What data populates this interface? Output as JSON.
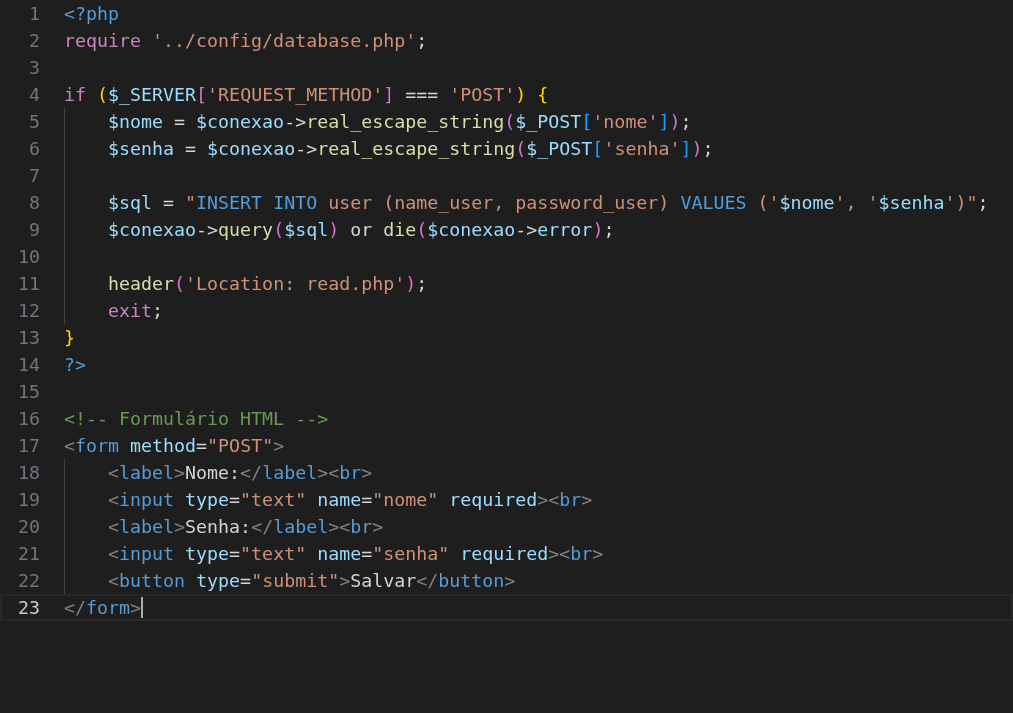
{
  "editor": {
    "lines": [
      {
        "number": "1",
        "selected": false,
        "indented": false,
        "tokens": [
          {
            "kind": "phptag",
            "text": "<?php"
          }
        ]
      },
      {
        "number": "2",
        "selected": false,
        "indented": false,
        "tokens": [
          {
            "kind": "keyword",
            "text": "require"
          },
          {
            "kind": "string",
            "text": " '../config/database.php'"
          },
          {
            "kind": "plain",
            "text": ";"
          }
        ]
      },
      {
        "number": "3",
        "selected": false,
        "indented": false
      },
      {
        "number": "4",
        "selected": false,
        "indented": false,
        "tokens": [
          {
            "kind": "keyword",
            "text": "if"
          },
          {
            "kind": "bracket1",
            "text": " ("
          },
          {
            "kind": "variable",
            "text": "$_SERVER"
          },
          {
            "kind": "bracket2",
            "text": "["
          },
          {
            "kind": "string",
            "text": "'REQUEST_METHOD'"
          },
          {
            "kind": "bracket2",
            "text": "]"
          },
          {
            "kind": "plain",
            "text": " === "
          },
          {
            "kind": "string",
            "text": "'POST'"
          },
          {
            "kind": "bracket1",
            "text": ")"
          },
          {
            "kind": "bracket1",
            "text": " {"
          }
        ]
      },
      {
        "number": "5",
        "selected": false,
        "indented": true,
        "tokens": [
          {
            "kind": "variable",
            "text": "$nome"
          },
          {
            "kind": "plain",
            "text": " = "
          },
          {
            "kind": "variable",
            "text": "$conexao"
          },
          {
            "kind": "plain",
            "text": "->"
          },
          {
            "kind": "function",
            "text": "real_escape_string"
          },
          {
            "kind": "bracket2",
            "text": "("
          },
          {
            "kind": "variable",
            "text": "$_POST"
          },
          {
            "kind": "bracket3",
            "text": "["
          },
          {
            "kind": "string",
            "text": "'nome'"
          },
          {
            "kind": "bracket3",
            "text": "]"
          },
          {
            "kind": "bracket2",
            "text": ")"
          },
          {
            "kind": "plain",
            "text": ";"
          }
        ]
      },
      {
        "number": "6",
        "selected": false,
        "indented": true,
        "tokens": [
          {
            "kind": "variable",
            "text": "$senha"
          },
          {
            "kind": "plain",
            "text": " = "
          },
          {
            "kind": "variable",
            "text": "$conexao"
          },
          {
            "kind": "plain",
            "text": "->"
          },
          {
            "kind": "function",
            "text": "real_escape_string"
          },
          {
            "kind": "bracket2",
            "text": "("
          },
          {
            "kind": "variable",
            "text": "$_POST"
          },
          {
            "kind": "bracket3",
            "text": "["
          },
          {
            "kind": "string",
            "text": "'senha'"
          },
          {
            "kind": "bracket3",
            "text": "]"
          },
          {
            "kind": "bracket2",
            "text": ")"
          },
          {
            "kind": "plain",
            "text": ";"
          }
        ]
      },
      {
        "number": "7",
        "selected": false,
        "indented": true
      },
      {
        "number": "8",
        "selected": false,
        "indented": true,
        "tokens": [
          {
            "kind": "variable",
            "text": "$sql"
          },
          {
            "kind": "plain",
            "text": " = "
          },
          {
            "kind": "string",
            "text": "\""
          },
          {
            "kind": "sql",
            "text": "INSERT INTO"
          },
          {
            "kind": "string",
            "text": " user (name_user, password_user) "
          },
          {
            "kind": "sql",
            "text": "VALUES"
          },
          {
            "kind": "string",
            "text": " ('"
          },
          {
            "kind": "variable",
            "text": "$nome"
          },
          {
            "kind": "string",
            "text": "', '"
          },
          {
            "kind": "variable",
            "text": "$senha"
          },
          {
            "kind": "string",
            "text": "')\""
          },
          {
            "kind": "plain",
            "text": ";"
          }
        ]
      },
      {
        "number": "9",
        "selected": false,
        "indented": true,
        "tokens": [
          {
            "kind": "variable",
            "text": "$conexao"
          },
          {
            "kind": "plain",
            "text": "->"
          },
          {
            "kind": "function",
            "text": "query"
          },
          {
            "kind": "bracket2",
            "text": "("
          },
          {
            "kind": "variable",
            "text": "$sql"
          },
          {
            "kind": "bracket2",
            "text": ")"
          },
          {
            "kind": "plain",
            "text": " or "
          },
          {
            "kind": "function",
            "text": "die"
          },
          {
            "kind": "bracket2",
            "text": "("
          },
          {
            "kind": "variable",
            "text": "$conexao"
          },
          {
            "kind": "plain",
            "text": "->"
          },
          {
            "kind": "variable",
            "text": "error"
          },
          {
            "kind": "bracket2",
            "text": ")"
          },
          {
            "kind": "plain",
            "text": ";"
          }
        ]
      },
      {
        "number": "10",
        "selected": false,
        "indented": true
      },
      {
        "number": "11",
        "selected": false,
        "indented": true,
        "tokens": [
          {
            "kind": "function",
            "text": "header"
          },
          {
            "kind": "bracket2",
            "text": "("
          },
          {
            "kind": "string",
            "text": "'Location: read.php'"
          },
          {
            "kind": "bracket2",
            "text": ")"
          },
          {
            "kind": "plain",
            "text": ";"
          }
        ]
      },
      {
        "number": "12",
        "selected": false,
        "indented": true,
        "tokens": [
          {
            "kind": "keyword",
            "text": "exit"
          },
          {
            "kind": "plain",
            "text": ";"
          }
        ]
      },
      {
        "number": "13",
        "selected": false,
        "indented": false,
        "tokens": [
          {
            "kind": "bracket1",
            "text": "}"
          }
        ]
      },
      {
        "number": "14",
        "selected": false,
        "indented": false,
        "tokens": [
          {
            "kind": "phptag",
            "text": "?>"
          }
        ]
      },
      {
        "number": "15",
        "selected": false,
        "indented": false
      },
      {
        "number": "16",
        "selected": false,
        "indented": false,
        "tokens": [
          {
            "kind": "comment",
            "text": "<!-- Formulário HTML -->"
          }
        ]
      },
      {
        "number": "17",
        "selected": false,
        "indented": false,
        "tokens": [
          {
            "kind": "angle",
            "text": "<"
          },
          {
            "kind": "tag",
            "text": "form"
          },
          {
            "kind": "attr",
            "text": " method"
          },
          {
            "kind": "plain",
            "text": "="
          },
          {
            "kind": "string",
            "text": "\"POST\""
          },
          {
            "kind": "angle",
            "text": ">"
          }
        ]
      },
      {
        "number": "18",
        "selected": false,
        "indented": true,
        "tokens": [
          {
            "kind": "angle",
            "text": "<"
          },
          {
            "kind": "tag",
            "text": "label"
          },
          {
            "kind": "angle",
            "text": ">"
          },
          {
            "kind": "plain",
            "text": "Nome:"
          },
          {
            "kind": "angle",
            "text": "</"
          },
          {
            "kind": "tag",
            "text": "label"
          },
          {
            "kind": "angle",
            "text": ">"
          },
          {
            "kind": "angle",
            "text": "<"
          },
          {
            "kind": "tag",
            "text": "br"
          },
          {
            "kind": "angle",
            "text": ">"
          }
        ]
      },
      {
        "number": "19",
        "selected": false,
        "indented": true,
        "tokens": [
          {
            "kind": "angle",
            "text": "<"
          },
          {
            "kind": "tag",
            "text": "input"
          },
          {
            "kind": "attr",
            "text": " type"
          },
          {
            "kind": "plain",
            "text": "="
          },
          {
            "kind": "string",
            "text": "\"text\""
          },
          {
            "kind": "attr",
            "text": " name"
          },
          {
            "kind": "plain",
            "text": "="
          },
          {
            "kind": "string",
            "text": "\"nome\""
          },
          {
            "kind": "attr",
            "text": " required"
          },
          {
            "kind": "angle",
            "text": ">"
          },
          {
            "kind": "angle",
            "text": "<"
          },
          {
            "kind": "tag",
            "text": "br"
          },
          {
            "kind": "angle",
            "text": ">"
          }
        ]
      },
      {
        "number": "20",
        "selected": false,
        "indented": true,
        "tokens": [
          {
            "kind": "angle",
            "text": "<"
          },
          {
            "kind": "tag",
            "text": "label"
          },
          {
            "kind": "angle",
            "text": ">"
          },
          {
            "kind": "plain",
            "text": "Senha:"
          },
          {
            "kind": "angle",
            "text": "</"
          },
          {
            "kind": "tag",
            "text": "label"
          },
          {
            "kind": "angle",
            "text": ">"
          },
          {
            "kind": "angle",
            "text": "<"
          },
          {
            "kind": "tag",
            "text": "br"
          },
          {
            "kind": "angle",
            "text": ">"
          }
        ]
      },
      {
        "number": "21",
        "selected": false,
        "indented": true,
        "tokens": [
          {
            "kind": "angle",
            "text": "<"
          },
          {
            "kind": "tag",
            "text": "input"
          },
          {
            "kind": "attr",
            "text": " type"
          },
          {
            "kind": "plain",
            "text": "="
          },
          {
            "kind": "string",
            "text": "\"text\""
          },
          {
            "kind": "attr",
            "text": " name"
          },
          {
            "kind": "plain",
            "text": "="
          },
          {
            "kind": "string",
            "text": "\"senha\""
          },
          {
            "kind": "attr",
            "text": " required"
          },
          {
            "kind": "angle",
            "text": ">"
          },
          {
            "kind": "angle",
            "text": "<"
          },
          {
            "kind": "tag",
            "text": "br"
          },
          {
            "kind": "angle",
            "text": ">"
          }
        ]
      },
      {
        "number": "22",
        "selected": false,
        "indented": true,
        "tokens": [
          {
            "kind": "angle",
            "text": "<"
          },
          {
            "kind": "tag",
            "text": "button"
          },
          {
            "kind": "attr",
            "text": " type"
          },
          {
            "kind": "plain",
            "text": "="
          },
          {
            "kind": "string",
            "text": "\"submit\""
          },
          {
            "kind": "angle",
            "text": ">"
          },
          {
            "kind": "plain",
            "text": "Salvar"
          },
          {
            "kind": "angle",
            "text": "</"
          },
          {
            "kind": "tag",
            "text": "button"
          },
          {
            "kind": "angle",
            "text": ">"
          }
        ]
      },
      {
        "number": "23",
        "selected": true,
        "indented": false,
        "tokens": [
          {
            "kind": "angle",
            "text": "</"
          },
          {
            "kind": "tag",
            "text": "form"
          },
          {
            "kind": "angle",
            "text": ">"
          }
        ]
      }
    ]
  }
}
